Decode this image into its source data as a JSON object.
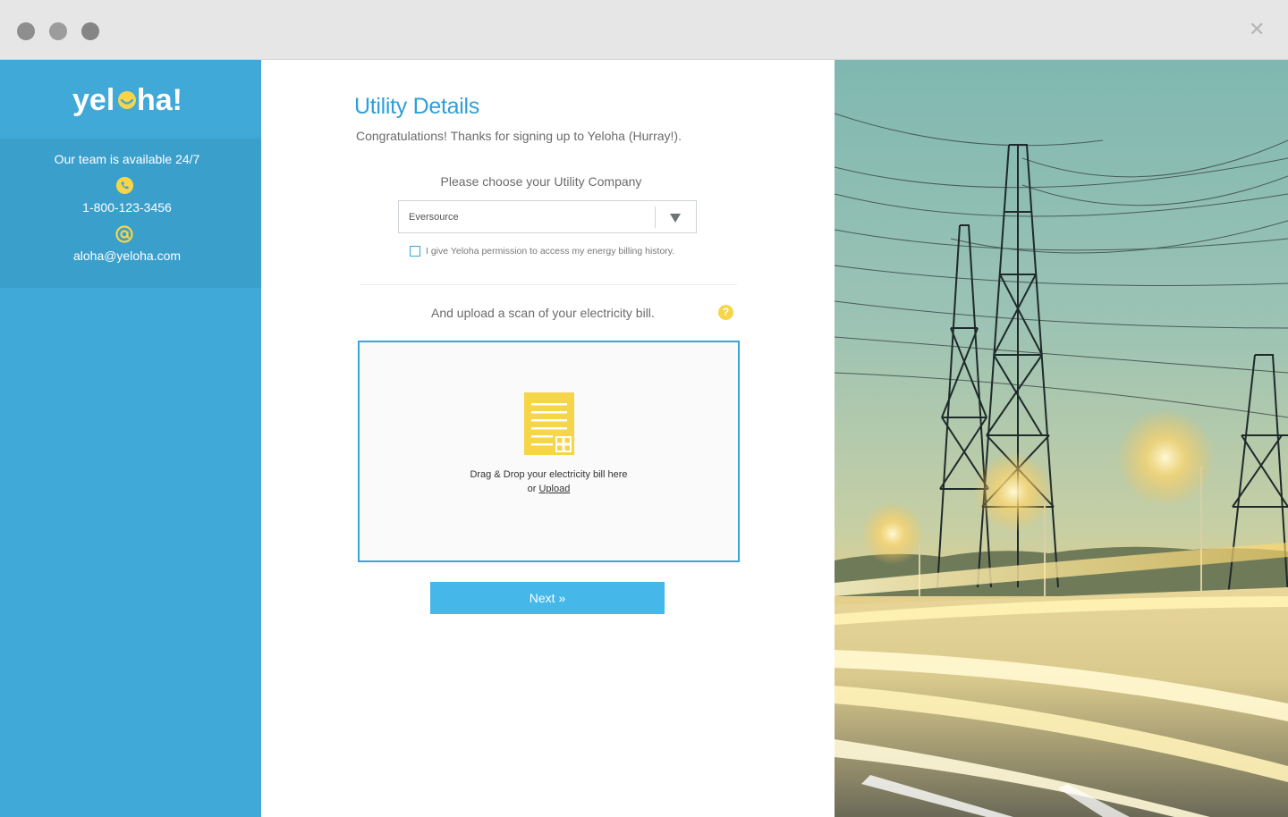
{
  "window": {
    "close_glyph": "✕"
  },
  "brand": {
    "logo_left": "yel",
    "logo_right": "ha!",
    "colors": {
      "sidebar": "#40a9d7",
      "accent_yellow": "#f7d548",
      "title_blue": "#2f9fd8",
      "button_blue": "#45b7e8"
    }
  },
  "sidebar": {
    "availability": "Our team is available 24/7",
    "phone": "1-800-123-3456",
    "email": "aloha@yeloha.com",
    "icons": [
      "phone-icon",
      "at-icon"
    ]
  },
  "form": {
    "title": "Utility Details",
    "subtitle": "Congratulations!  Thanks for signing up to Yeloha (Hurray!).",
    "choose_label": "Please choose your Utility Company",
    "utility_selected": "Eversource",
    "permission_label": "I give Yeloha permission to access my energy billing history.",
    "permission_checked": false,
    "upload_prompt": "And upload a scan of your electricity bill.",
    "help_glyph": "?",
    "dropzone_text": "Drag & Drop your electricity bill here",
    "dropzone_or": "or",
    "upload_link": "Upload",
    "next_button": "Next »"
  }
}
